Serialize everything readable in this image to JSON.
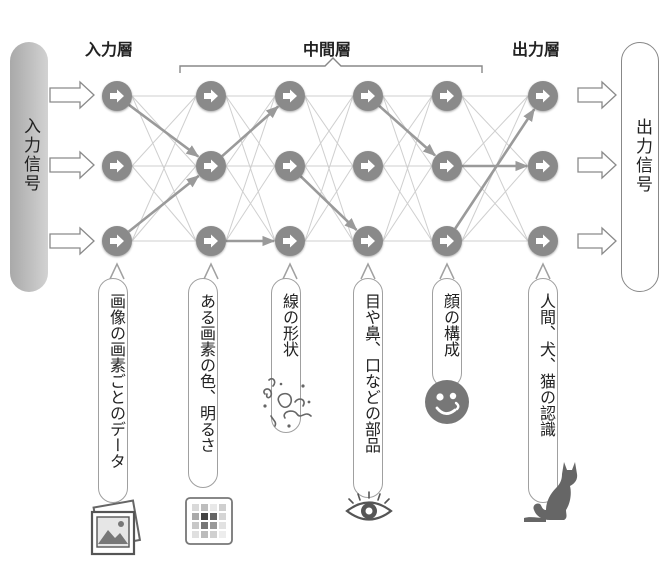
{
  "layers": {
    "input": "入力層",
    "hidden": "中間層",
    "output": "出力層"
  },
  "side_labels": {
    "input_signal": "入力信号",
    "output_signal": "出力信号"
  },
  "callouts": [
    {
      "text": "画像の画素ごとのデータ",
      "icon": "photo-icon"
    },
    {
      "text": "ある画素の色、明るさ",
      "icon": "pixel-grid-icon"
    },
    {
      "text": "線の形状",
      "icon": "scribble-icon"
    },
    {
      "text": "目や鼻、口などの部品",
      "icon": "eye-icon"
    },
    {
      "text": "顔の構成",
      "icon": "smiley-face-icon"
    },
    {
      "text": "人間、犬、猫の認識",
      "icon": "cat-icon"
    }
  ],
  "colors": {
    "node": "#8a8a8a",
    "connection_light": "#cfcfcf",
    "connection_strong": "#9a9a9a",
    "arrow_outline": "#8a8a8a"
  }
}
